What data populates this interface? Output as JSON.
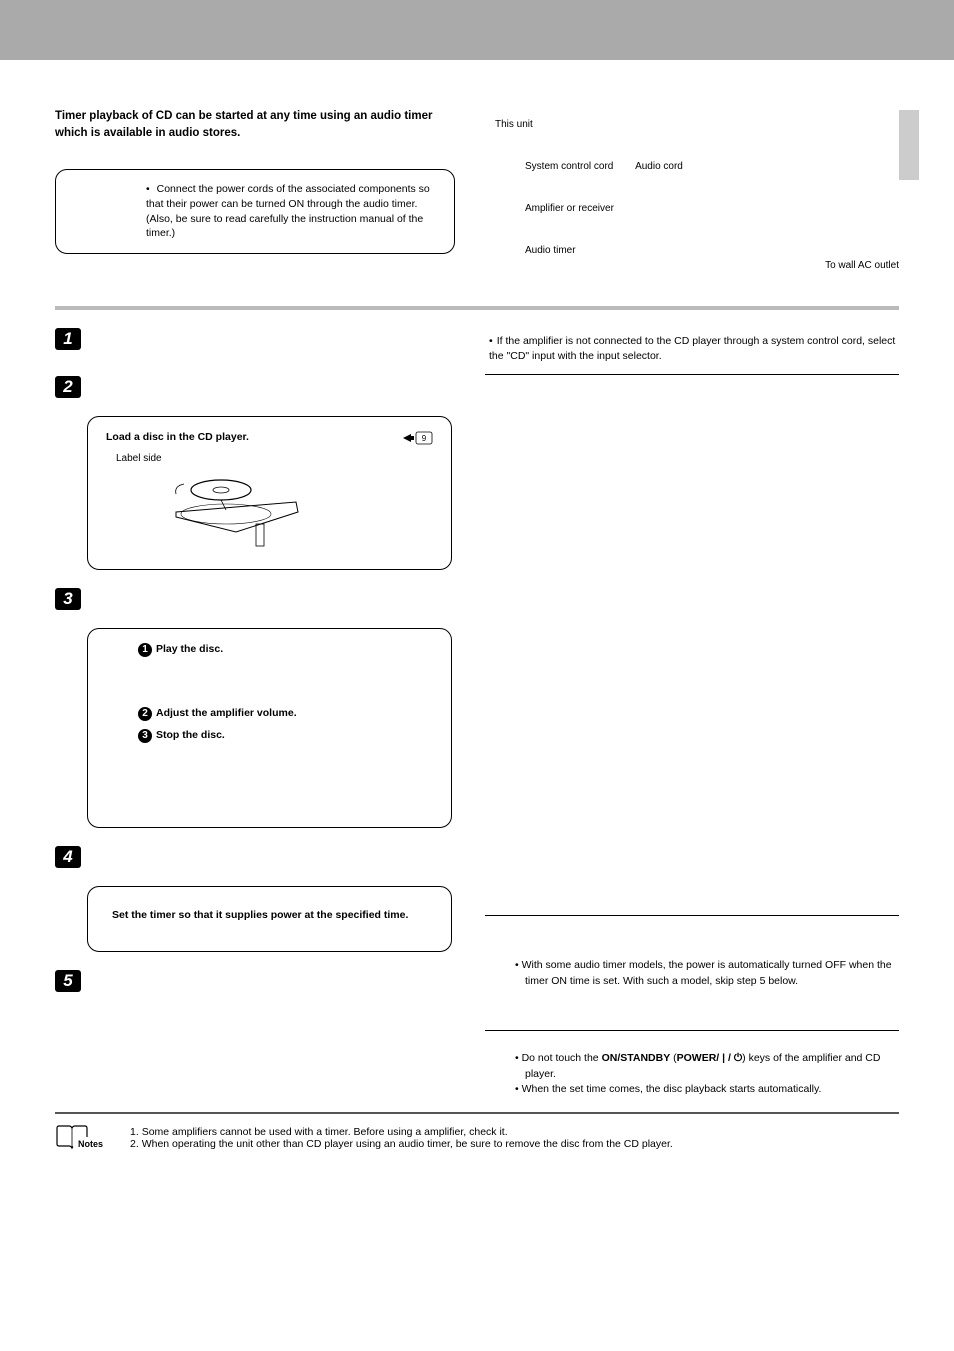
{
  "intro": "Timer playback of CD can be started at any time using an audio timer which is available in audio stores.",
  "connect": {
    "line1": "Connect the power cords of the associated components so that their power can be turned ON through the audio timer.",
    "line2": "(Also, be sure to read carefully the instruction manual of the timer.)"
  },
  "diagram": {
    "this_unit": "This unit",
    "sys_cord": "System control cord",
    "audio_cord": "Audio cord",
    "amp": "Amplifier or receiver",
    "timer": "Audio timer",
    "to_wall": "To wall AC outlet"
  },
  "steps": {
    "s1": "1",
    "s2": "2",
    "s2_text": "Load a disc in the CD player.",
    "s2_label": "Label side",
    "s2_pageref": "9",
    "s3": "3",
    "s3_a": "Play the disc.",
    "s3_b": "Adjust the amplifier volume.",
    "s3_c": "Stop the disc.",
    "s4": "4",
    "s4_text": "Set the timer so that it supplies power at the specified time.",
    "s5": "5"
  },
  "right_notes": {
    "amp_note": "If the amplifier is not connected to the CD player through a system control cord, select the \"CD\" input with the input selector.",
    "timer_note": "With some audio timer models, the power is automatically turned OFF when the timer ON time is set. With such a model, skip step 5 below.",
    "standby_a": "Do not touch the ",
    "standby_b": "ON/STANDBY",
    "standby_c": " (",
    "standby_d": "POWER/",
    "standby_e": ") keys of the amplifier and CD player.",
    "standby_final": "When the set time comes, the disc playback starts automatically."
  },
  "footer": {
    "notes_label": "Notes",
    "n1": "1. Some amplifiers cannot be used with a timer. Before using a amplifier, check it.",
    "n2": "2. When operating the unit other than CD player using an audio timer, be sure to remove the disc from the CD player."
  }
}
